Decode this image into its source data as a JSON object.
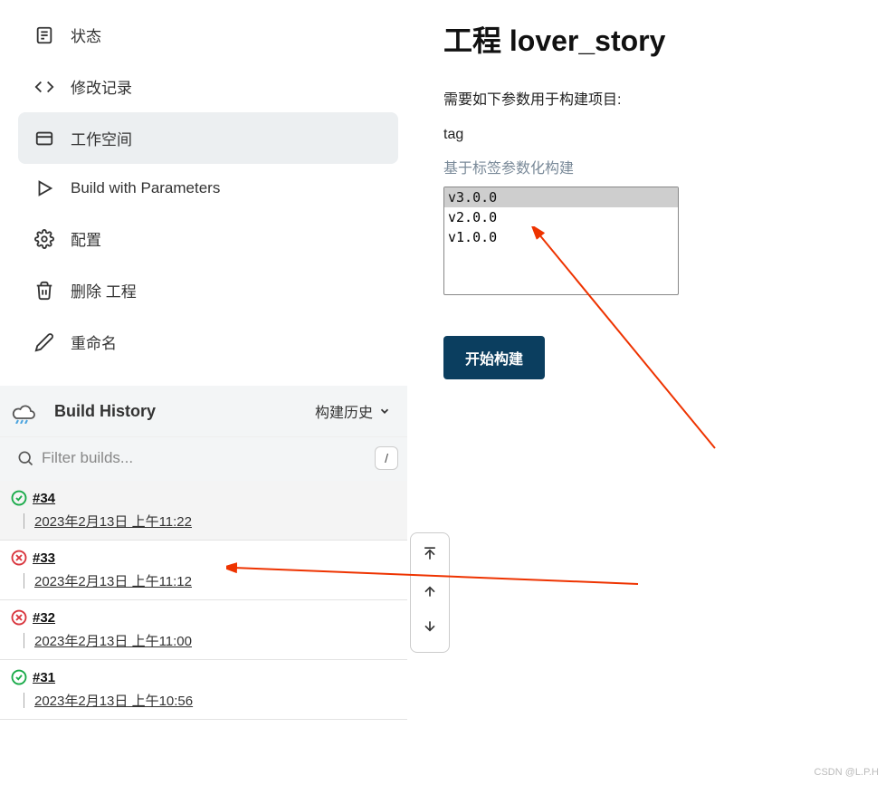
{
  "nav": {
    "items": [
      {
        "label": "状态",
        "icon": "status-icon"
      },
      {
        "label": "修改记录",
        "icon": "changes-icon"
      },
      {
        "label": "工作空间",
        "icon": "workspace-icon",
        "active": true
      },
      {
        "label": "Build with Parameters",
        "icon": "play-icon"
      },
      {
        "label": "配置",
        "icon": "gear-icon"
      },
      {
        "label": "删除 工程",
        "icon": "delete-icon"
      },
      {
        "label": "重命名",
        "icon": "rename-icon"
      }
    ]
  },
  "build_history": {
    "title": "Build History",
    "toggle_label": "构建历史",
    "filter_placeholder": "Filter builds...",
    "kbd_hint": "/",
    "builds": [
      {
        "num": "#34",
        "time": "2023年2月13日 上午11:22",
        "status": "success"
      },
      {
        "num": "#33",
        "time": "2023年2月13日 上午11:12",
        "status": "fail"
      },
      {
        "num": "#32",
        "time": "2023年2月13日 上午11:00",
        "status": "fail"
      },
      {
        "num": "#31",
        "time": "2023年2月13日 上午10:56",
        "status": "success"
      }
    ]
  },
  "main": {
    "title": "工程 lover_story",
    "desc": "需要如下参数用于构建项目:",
    "param_name": "tag",
    "param_hint": "基于标签参数化构建",
    "tag_options": [
      "v3.0.0",
      "v2.0.0",
      "v1.0.0"
    ],
    "build_button": "开始构建"
  },
  "watermark": "CSDN @L.P.H"
}
